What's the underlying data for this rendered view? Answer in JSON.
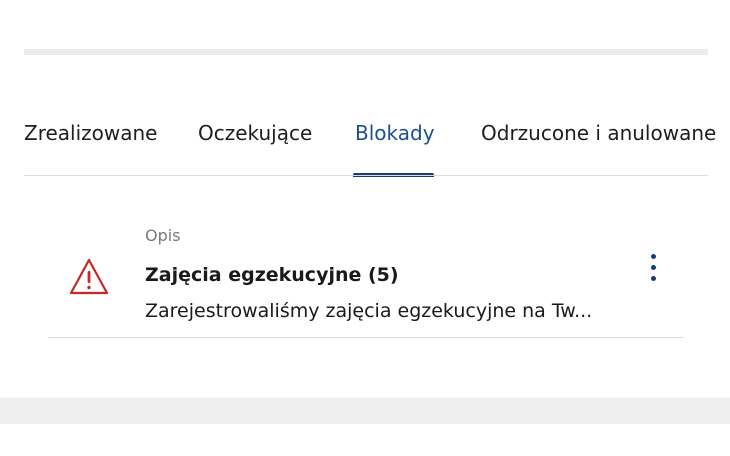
{
  "tabs": [
    {
      "label": "Zrealizowane",
      "active": false
    },
    {
      "label": "Oczekujące",
      "active": false
    },
    {
      "label": "Blokady",
      "active": true
    },
    {
      "label": "Odrzucone i anulowane",
      "active": false
    }
  ],
  "list": {
    "column_header": "Opis",
    "items": [
      {
        "icon": "warning-triangle-icon",
        "title": "Zajęcia egzekucyjne (5)",
        "description": "Zarejestrowaliśmy zajęcia egzekucyjne na Tw..."
      }
    ]
  },
  "colors": {
    "accent": "#123e7a",
    "active_tab_text": "#1d4f8f",
    "warning": "#c62828"
  }
}
